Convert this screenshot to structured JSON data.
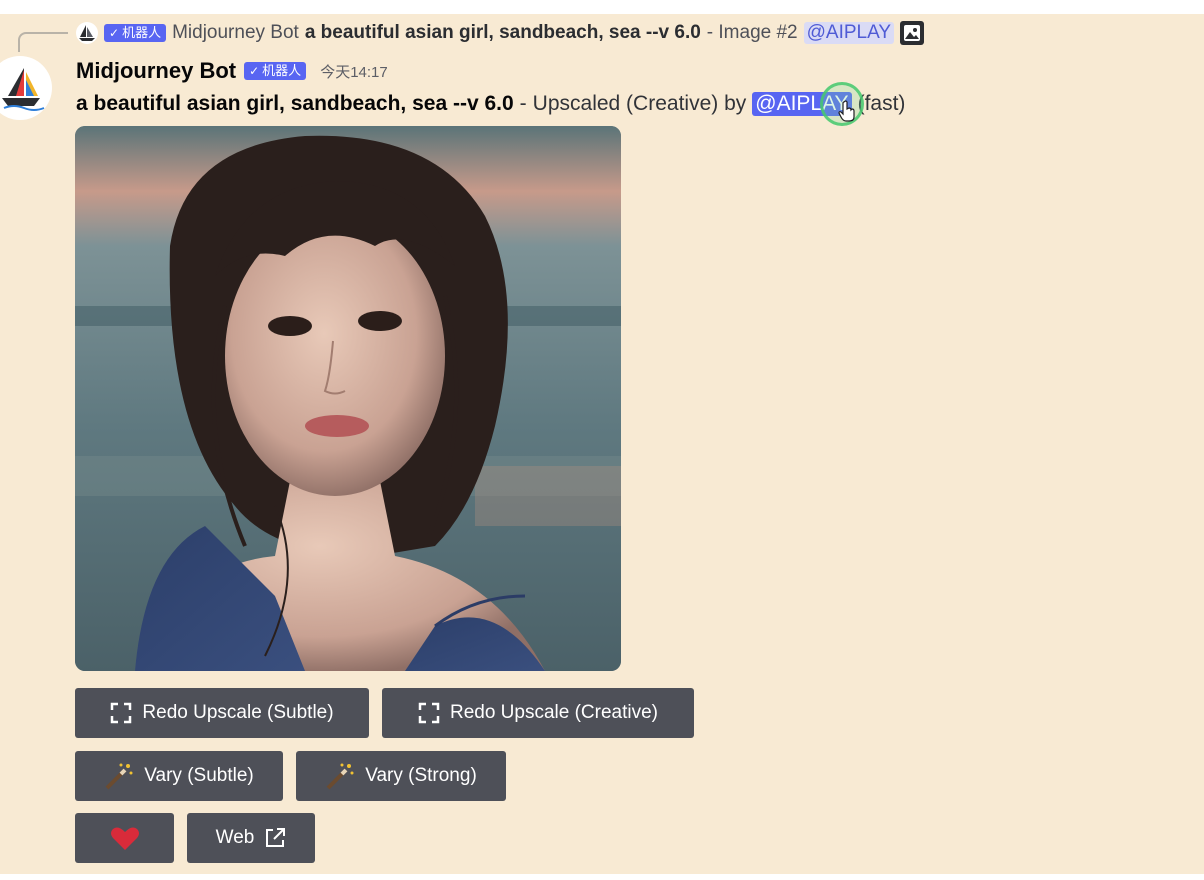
{
  "reply": {
    "author": "Midjourney Bot",
    "bot_badge": "机器人",
    "prompt": "a beautiful asian girl, sandbeach, sea --v 6.0",
    "suffix": "- Image #2",
    "mention": "@AIPLAY"
  },
  "message": {
    "author": "Midjourney Bot",
    "bot_badge": "机器人",
    "timestamp": "今天14:17",
    "prompt": "a beautiful asian girl, sandbeach, sea --v 6.0",
    "separator": "-",
    "action_text": "Upscaled (Creative) by",
    "mention": "@AIPLAY",
    "speed": "(fast)"
  },
  "buttons": {
    "redo_subtle": "Redo Upscale (Subtle)",
    "redo_creative": "Redo Upscale (Creative)",
    "vary_subtle": "Vary (Subtle)",
    "vary_strong": "Vary (Strong)",
    "web": "Web"
  },
  "icons": {
    "expand": "expand-icon",
    "wand": "magic-wand-icon",
    "heart": "heart-icon",
    "external": "external-link-icon"
  },
  "colors": {
    "background": "#f8ead3",
    "button": "#4e5058",
    "badge": "#5865f2",
    "heart": "#d92b3a"
  }
}
